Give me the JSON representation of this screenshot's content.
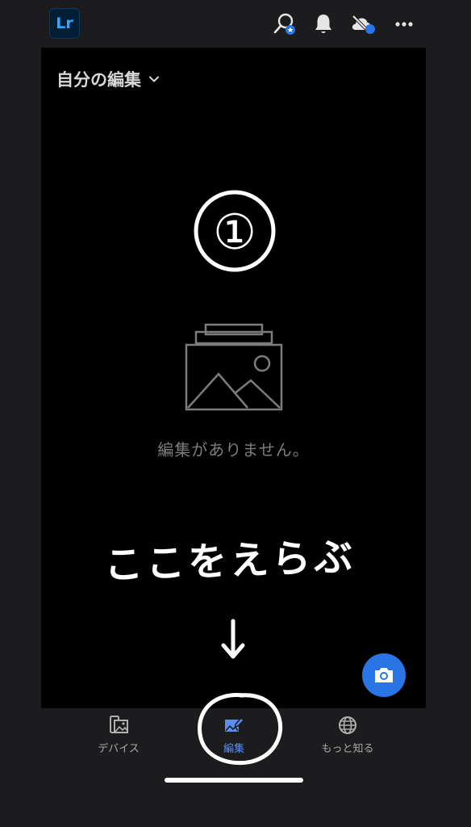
{
  "header": {
    "logo_text": "Lr",
    "icons": [
      "search-people-icon",
      "bell-icon",
      "cloud-sync-icon",
      "more-icon"
    ],
    "accent": "#2a75e6"
  },
  "main": {
    "view_selector": "自分の編集",
    "step_number": "①",
    "empty_message": "編集がありません。",
    "handwritten_note": "ここをえらぶ"
  },
  "bottom_nav": {
    "items": [
      {
        "label": "デバイス",
        "icon": "device-photos-icon"
      },
      {
        "label": "編集",
        "icon": "edit-photo-icon",
        "active": true
      },
      {
        "label": "もっと知る",
        "icon": "globe-icon"
      }
    ]
  }
}
